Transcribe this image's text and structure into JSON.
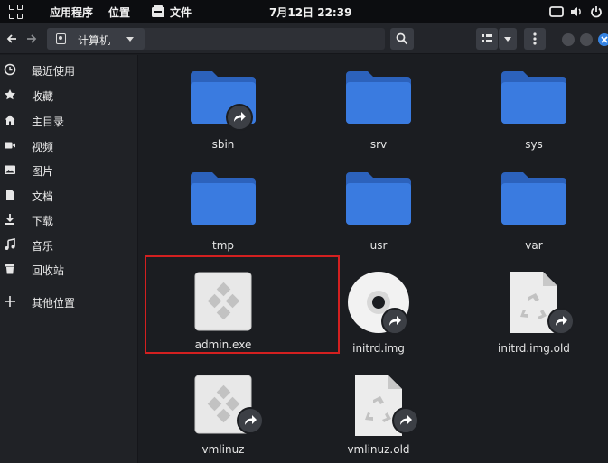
{
  "topbar": {
    "apps_label": "应用程序",
    "places_label": "位置",
    "files_label": "文件",
    "clock": "7月12日  22:39"
  },
  "toolbar": {
    "back_icon": "arrow-left-icon",
    "forward_icon": "arrow-right-icon",
    "location": "计算机"
  },
  "sidebar": {
    "items": [
      {
        "label": "最近使用",
        "icon": "clock-icon"
      },
      {
        "label": "收藏",
        "icon": "star-icon"
      },
      {
        "label": "主目录",
        "icon": "home-icon"
      },
      {
        "label": "视频",
        "icon": "video-icon"
      },
      {
        "label": "图片",
        "icon": "image-icon"
      },
      {
        "label": "文档",
        "icon": "document-icon"
      },
      {
        "label": "下载",
        "icon": "download-icon"
      },
      {
        "label": "音乐",
        "icon": "music-icon"
      },
      {
        "label": "回收站",
        "icon": "trash-icon"
      },
      {
        "label": "其他位置",
        "icon": "plus-icon"
      }
    ]
  },
  "files": [
    {
      "name": "sbin",
      "type": "folder-link"
    },
    {
      "name": "srv",
      "type": "folder"
    },
    {
      "name": "sys",
      "type": "folder"
    },
    {
      "name": "tmp",
      "type": "folder"
    },
    {
      "name": "usr",
      "type": "folder"
    },
    {
      "name": "var",
      "type": "folder"
    },
    {
      "name": "admin.exe",
      "type": "executable"
    },
    {
      "name": "initrd.img",
      "type": "disc-link"
    },
    {
      "name": "initrd.img.old",
      "type": "archive-link"
    },
    {
      "name": "vmlinuz",
      "type": "executable-link"
    },
    {
      "name": "vmlinuz.old",
      "type": "archive-link"
    }
  ],
  "colors": {
    "folder_blue": "#3a7be0",
    "folder_blue_dark": "#2c62bc",
    "highlight_red": "#d32020",
    "close_blue": "#3584e4"
  }
}
